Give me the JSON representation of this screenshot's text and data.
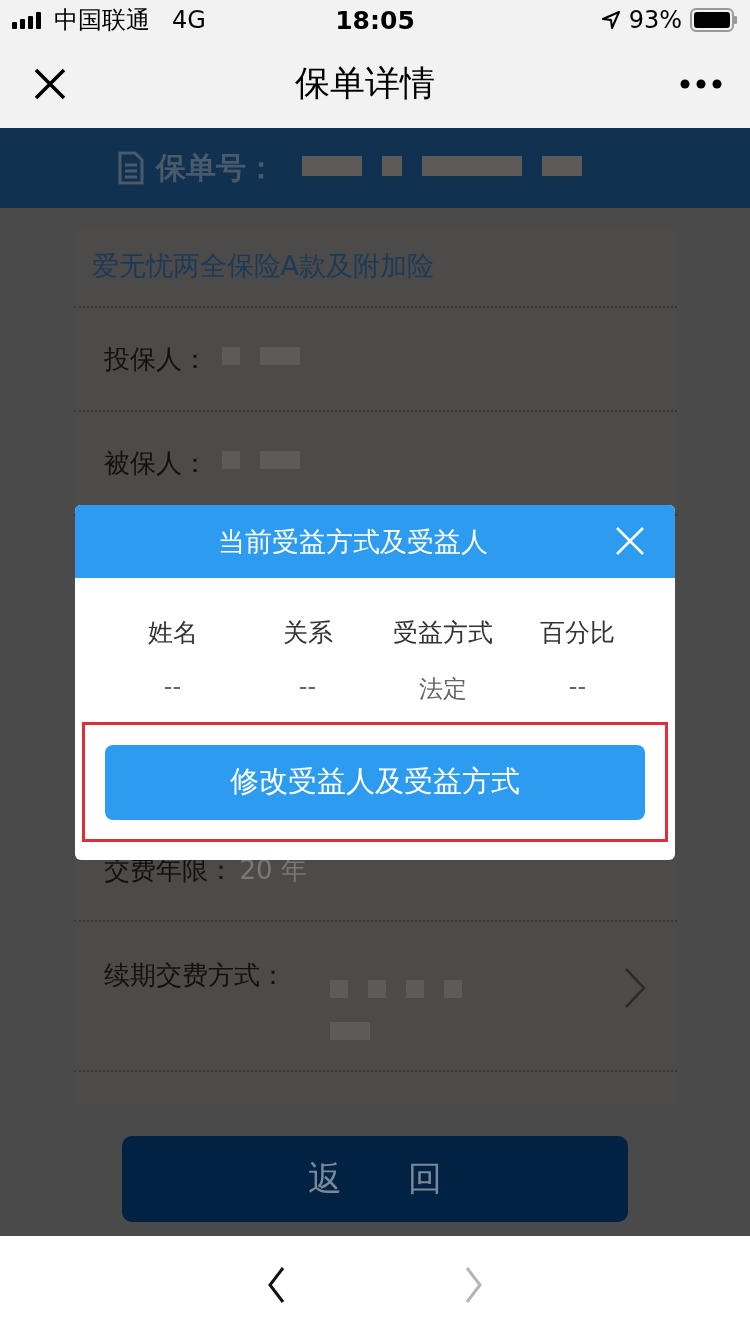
{
  "status_bar": {
    "carrier": "中国联通",
    "network": "4G",
    "time": "18:05",
    "battery": "93%"
  },
  "nav_bar": {
    "title": "保单详情"
  },
  "policy_header": {
    "label": "保单号：",
    "masked": true
  },
  "policy_card": {
    "product": "爱无忧两全保险A款及附加险",
    "rows_top": [
      {
        "label": "投保人：",
        "masked": true
      },
      {
        "label": "被保人：",
        "masked": true
      }
    ],
    "rows_bottom": [
      {
        "label": "交费年限：",
        "value": "20 年",
        "masked": false
      },
      {
        "label": "续期交费方式：",
        "masked": true,
        "has_link": true
      }
    ]
  },
  "return_button": "返 回",
  "dialog": {
    "title": "当前受益方式及受益人",
    "columns": [
      "姓名",
      "关系",
      "受益方式",
      "百分比"
    ],
    "rows": [
      [
        "--",
        "--",
        "法定",
        "--"
      ]
    ],
    "action": "修改受益人及受益方式",
    "highlighted": true
  },
  "browser_nav": [
    {
      "kind": "back",
      "disabled": false
    },
    {
      "kind": "forward",
      "disabled": true
    }
  ]
}
